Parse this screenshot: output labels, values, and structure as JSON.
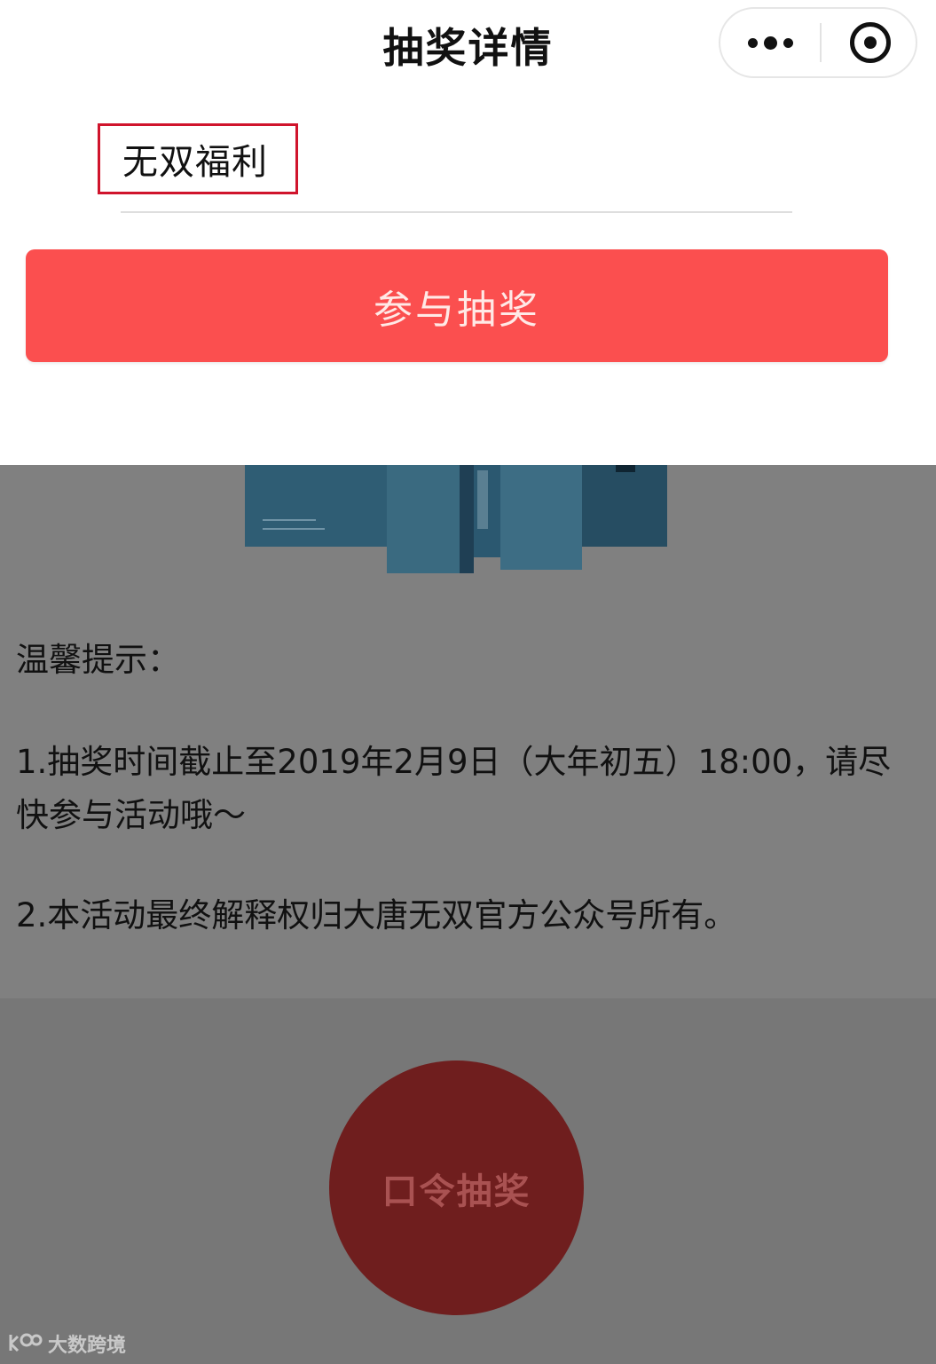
{
  "navbar": {
    "title": "抽奖详情",
    "more_icon": "more-dots-icon",
    "close_icon": "target-close-icon"
  },
  "lottery_form": {
    "passcode_value": "无双福利",
    "join_button": "参与抽奖",
    "highlight_color": "#d0142c",
    "button_color": "#fb4f4f"
  },
  "background_content": {
    "tips_title": "温馨提示：",
    "tip_1": "1.抽奖时间截止至2019年2月9日（大年初五）18:00，请尽快参与活动哦～",
    "tip_2": "2.本活动最终解释权归大唐无双官方公众号所有。",
    "passcode_button": "口令抽奖",
    "passcode_button_color": "#6f1e1e"
  },
  "watermark": {
    "text": "大数跨境"
  }
}
